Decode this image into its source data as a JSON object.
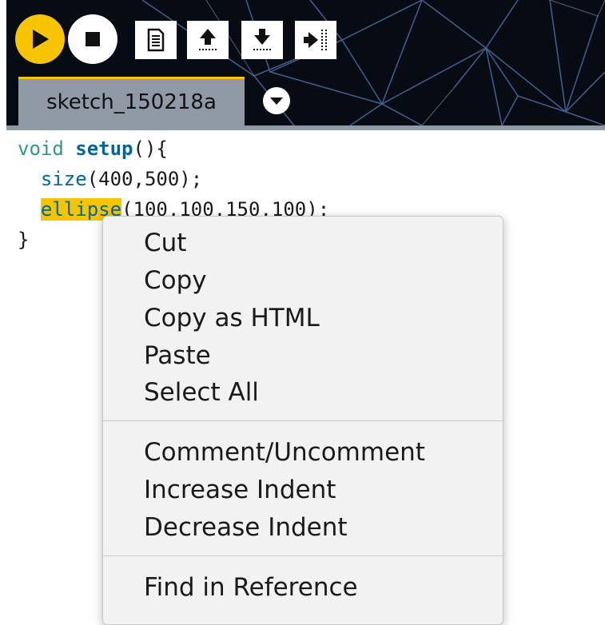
{
  "toolbar": {
    "run_icon": "play-icon",
    "stop_icon": "stop-icon",
    "new_icon": "new-sketch-icon",
    "open_icon": "open-icon",
    "save_icon": "save-icon",
    "export_icon": "export-icon",
    "accent_color": "#f6c400"
  },
  "tabs": {
    "active_label": "sketch_150218a",
    "menu_icon": "chevron-down-icon"
  },
  "code": {
    "line1_type": "void",
    "line1_fn": "setup",
    "line1_rest": "(){",
    "line2_indent": "  ",
    "line2_fn": "size",
    "line2_rest": "(400,500);",
    "line3_indent": "  ",
    "line3_fn": "ellipse",
    "line3_rest": "(100,100,150,100);",
    "line4": "}"
  },
  "context_menu": {
    "items_group1": [
      "Cut",
      "Copy",
      "Copy as HTML",
      "Paste",
      "Select All"
    ],
    "items_group2": [
      "Comment/Uncomment",
      "Increase Indent",
      "Decrease Indent"
    ],
    "items_group3": [
      "Find in Reference"
    ]
  }
}
